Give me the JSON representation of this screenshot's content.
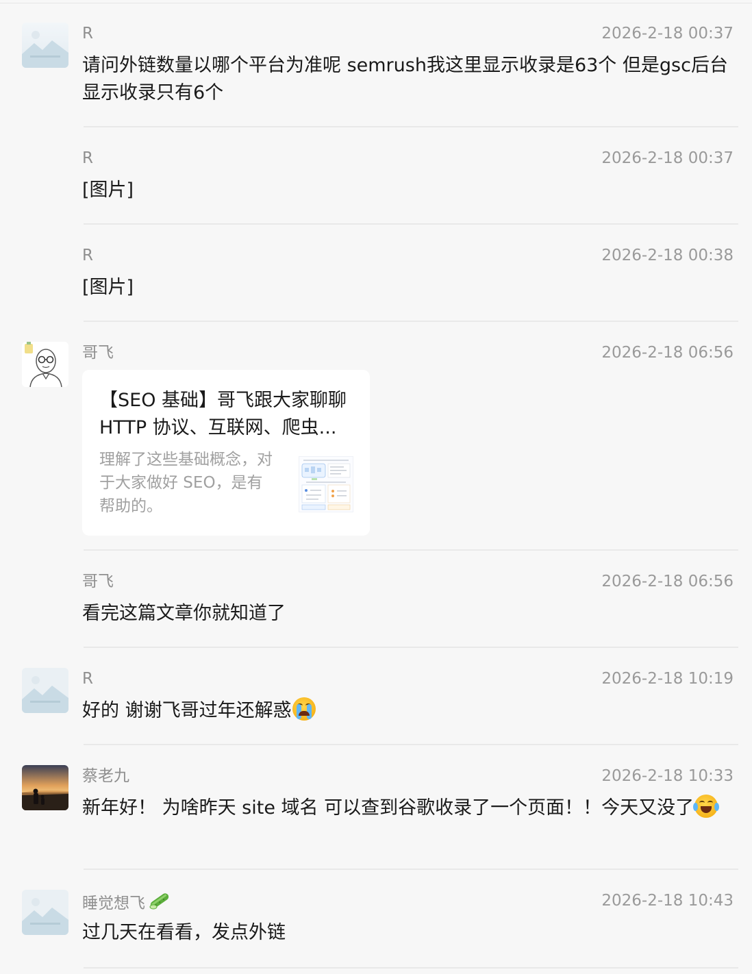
{
  "messages": [
    {
      "name": "R",
      "time": "2026-2-18 00:37",
      "text": "请问外链数量以哪个平台为准呢  semrush我这里显示收录是63个  但是gsc后台显示收录只有6个"
    },
    {
      "name": "R",
      "time": "2026-2-18 00:37",
      "text": "[图片]"
    },
    {
      "name": "R",
      "time": "2026-2-18 00:38",
      "text": "[图片]"
    },
    {
      "name": "哥飞",
      "time": "2026-2-18 06:56",
      "card": {
        "title": "【SEO 基础】哥飞跟大家聊聊 HTTP 协议、互联网、爬虫...",
        "desc": "理解了这些基础概念，对于大家做好 SEO，是有帮助的。",
        "thumbnail_icon": "article-diagram-thumbnail"
      }
    },
    {
      "name": "哥飞",
      "time": "2026-2-18 06:56",
      "text": "看完这篇文章你就知道了"
    },
    {
      "name": "R",
      "time": "2026-2-18 10:19",
      "text": "好的  谢谢飞哥过年还解惑",
      "emoji": "loudly-crying-face-icon"
    },
    {
      "name": "蔡老九",
      "time": "2026-2-18 10:33",
      "text": "新年好！ 为啥昨天 site 域名 可以查到谷歌收录了一个页面！！今天又没了",
      "emoji": "tears-of-joy-icon"
    },
    {
      "name": "睡觉想飞",
      "name_emoji": "cucumber-icon",
      "time": "2026-2-18 10:43",
      "text": "过几天在看看，发点外链"
    }
  ],
  "colors": {
    "background": "#f7f7f7",
    "name": "#8f8f8f",
    "timestamp": "#9a9a9a",
    "card": "#ffffff"
  }
}
